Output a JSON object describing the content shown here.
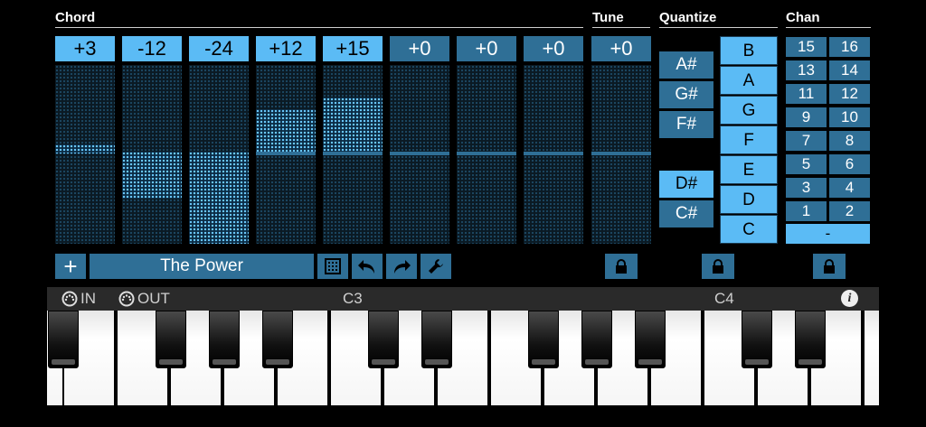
{
  "sections": {
    "chord": "Chord",
    "tune": "Tune",
    "quantize": "Quantize",
    "chan": "Chan"
  },
  "chord_columns": [
    {
      "label": "+3",
      "active": true
    },
    {
      "label": "-12",
      "active": true
    },
    {
      "label": "-24",
      "active": true
    },
    {
      "label": "+12",
      "active": true
    },
    {
      "label": "+15",
      "active": true
    },
    {
      "label": "+0",
      "active": false
    },
    {
      "label": "+0",
      "active": false
    },
    {
      "label": "+0",
      "active": false
    }
  ],
  "tune": {
    "label": "+0"
  },
  "quantize": {
    "black_keys": [
      {
        "label": "A#",
        "on": false
      },
      {
        "label": "G#",
        "on": false
      },
      {
        "label": "F#",
        "on": false
      },
      {
        "label": "D#",
        "on": true
      },
      {
        "label": "C#",
        "on": false
      }
    ],
    "white_keys": [
      "B",
      "A",
      "G",
      "F",
      "E",
      "D",
      "C"
    ]
  },
  "channels": [
    "15",
    "16",
    "13",
    "14",
    "11",
    "12",
    "9",
    "10",
    "7",
    "8",
    "5",
    "6",
    "3",
    "4",
    "1",
    "2"
  ],
  "channel_all": "-",
  "toolbar": {
    "add": "+",
    "preset_name": "The Power"
  },
  "keyboard": {
    "in_label": "IN",
    "out_label": "OUT",
    "c3": "C3",
    "c4": "C4",
    "info": "i"
  },
  "colors": {
    "accent": "#5bbbf5",
    "inactive": "#2f6f96",
    "background": "#000000"
  }
}
